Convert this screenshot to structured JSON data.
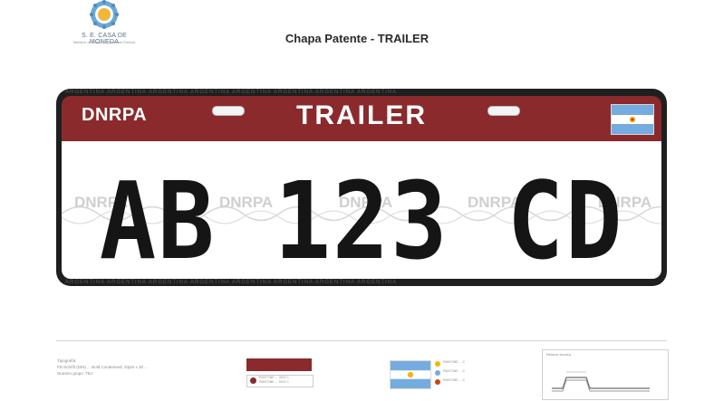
{
  "header": {
    "org_name": "S. E. CASA DE MONEDA",
    "org_subtitle": "Ministerio de Economía y Finanzas Públicas",
    "doc_title": "Chapa Patente - TRAILER"
  },
  "plate": {
    "agency": "DNRPA",
    "category": "TRAILER",
    "number": "AB 123 CD",
    "watermark": "DNRPA",
    "border_text": "ARGENTINA ARGENTINA ARGENTINA ARGENTINA ARGENTINA ARGENTINA ARGENTINA ARGENTINA",
    "colors": {
      "band": "#8a2a2c",
      "frame": "#1f1f1f",
      "characters": "#151515",
      "flag_blue": "#74acdf",
      "flag_sun": "#f6b40e"
    }
  },
  "footer": {
    "typography": [
      "Tipografía:",
      "FE-Schrift (DIN) ... Bold Condensed, 33pm x 30 ...",
      "Numero grupo. TEJ"
    ],
    "color_labels": [
      "PANTONE ... 7623 C",
      "PANTONE ... 7623 C"
    ],
    "flag_labels": [
      "PANTONE ... C",
      "PANTONE ... C",
      "PANTONE ... C"
    ],
    "security_title": "Relieve técnico"
  }
}
